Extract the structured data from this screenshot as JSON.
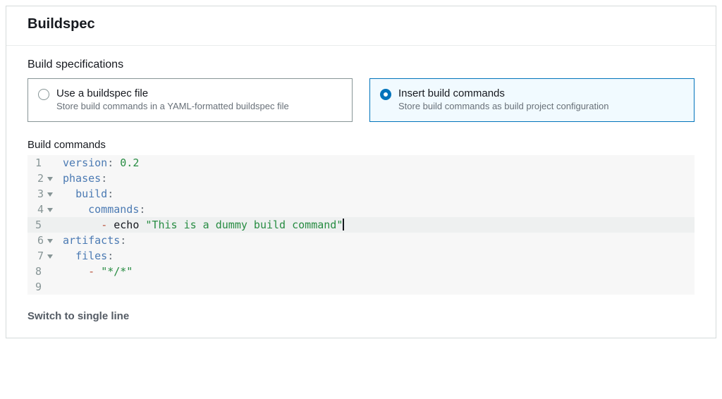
{
  "panel": {
    "title": "Buildspec"
  },
  "spec_section_title": "Build specifications",
  "options": [
    {
      "title": "Use a buildspec file",
      "desc": "Store build commands in a YAML-formatted buildspec file",
      "selected": false
    },
    {
      "title": "Insert build commands",
      "desc": "Store build commands as build project configuration",
      "selected": true
    }
  ],
  "commands_label": "Build commands",
  "code": {
    "l1_key": "version",
    "l1_val": "0.2",
    "l2_key": "phases",
    "l3_key": "build",
    "l4_key": "commands",
    "l5_dash": "- ",
    "l5_cmd": "echo ",
    "l5_str": "\"This is a dummy build command\"",
    "l6_key": "artifacts",
    "l7_key": "files",
    "l8_dash": "- ",
    "l8_str": "\"*/*\"",
    "ln1": "1",
    "ln2": "2",
    "ln3": "3",
    "ln4": "4",
    "ln5": "5",
    "ln6": "6",
    "ln7": "7",
    "ln8": "8",
    "ln9": "9"
  },
  "switch_label": "Switch to single line"
}
